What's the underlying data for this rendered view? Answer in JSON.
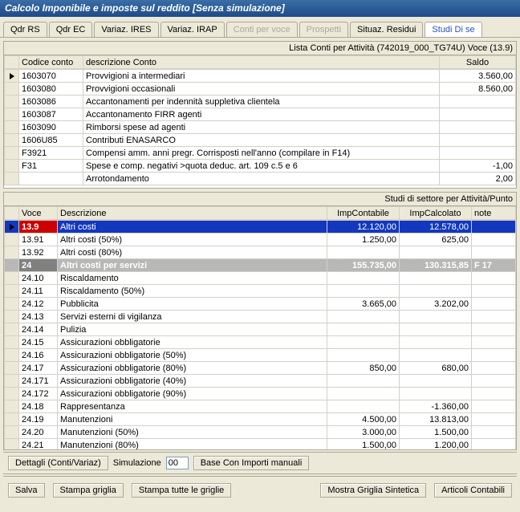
{
  "title": "Calcolo Imponibile e imposte sul reddito [Senza simulazione]",
  "tabs": [
    {
      "label": "Qdr RS",
      "state": "normal"
    },
    {
      "label": "Qdr EC",
      "state": "normal"
    },
    {
      "label": "Variaz. IRES",
      "state": "normal"
    },
    {
      "label": "Variaz. IRAP",
      "state": "normal"
    },
    {
      "label": "Conti per voce",
      "state": "disabled"
    },
    {
      "label": "Prospetti",
      "state": "disabled"
    },
    {
      "label": "Situaz. Residui",
      "state": "normal"
    },
    {
      "label": "Studi Di se",
      "state": "active"
    }
  ],
  "grid1": {
    "header_title": "Lista Conti per Attività (742019_000_TG74U)  Voce (13.9)",
    "columns": [
      "Codice conto",
      "descrizione Conto",
      "Saldo"
    ],
    "rows": [
      {
        "indicator": true,
        "codice": "1603070",
        "desc": "Provvigioni a intermediari",
        "saldo": "3.560,00"
      },
      {
        "codice": "1603080",
        "desc": "Provvigioni occasionali",
        "saldo": "8.560,00"
      },
      {
        "codice": "1603086",
        "desc": "Accantonamenti per indennità suppletiva clientela",
        "saldo": ""
      },
      {
        "codice": "1603087",
        "desc": "Accantonamento FIRR agenti",
        "saldo": ""
      },
      {
        "codice": "1603090",
        "desc": "Rimborsi spese ad agenti",
        "saldo": ""
      },
      {
        "codice": "1606U85",
        "desc": "Contributi ENASARCO",
        "saldo": ""
      },
      {
        "codice": "F3921",
        "desc": "Compensi amm. anni pregr. Corrisposti nell'anno (compilare in F14)",
        "saldo": ""
      },
      {
        "codice": "F31",
        "desc": "Spese e comp. negativi >quota deduc. art. 109 c.5 e 6",
        "saldo": "-1,00"
      },
      {
        "codice": "",
        "desc": "Arrotondamento",
        "saldo": "2,00"
      }
    ]
  },
  "grid2": {
    "header_title": "Studi di settore per  Attività/Punto",
    "columns": [
      "Voce",
      "Descrizione",
      "ImpContabile",
      "ImpCalcolato",
      "note"
    ],
    "rows": [
      {
        "indicator": true,
        "style": "sel-red",
        "voce": "13.9",
        "desc": "Altri costi",
        "impcont": "12.120,00",
        "impcalc": "12.578,00",
        "note": ""
      },
      {
        "voce": "13.91",
        "desc": "Altri costi (50%)",
        "impcont": "1.250,00",
        "impcalc": "625,00",
        "note": ""
      },
      {
        "voce": "13.92",
        "desc": "Altri costi (80%)",
        "impcont": "",
        "impcalc": "",
        "note": ""
      },
      {
        "style": "sel-grey",
        "voce": "24",
        "desc": "Altri costi per servizi",
        "impcont": "155.735,00",
        "impcalc": "130.315,85",
        "note": "F 17"
      },
      {
        "voce": "24.10",
        "desc": "Riscaldamento",
        "impcont": "",
        "impcalc": "",
        "note": ""
      },
      {
        "voce": "24.11",
        "desc": "Riscaldamento (50%)",
        "impcont": "",
        "impcalc": "",
        "note": ""
      },
      {
        "voce": "24.12",
        "desc": "Pubblicita",
        "impcont": "3.665,00",
        "impcalc": "3.202,00",
        "note": ""
      },
      {
        "voce": "24.13",
        "desc": "Servizi esterni di vigilanza",
        "impcont": "",
        "impcalc": "",
        "note": ""
      },
      {
        "voce": "24.14",
        "desc": "Pulizia",
        "impcont": "",
        "impcalc": "",
        "note": ""
      },
      {
        "voce": "24.15",
        "desc": "Assicurazioni obbligatorie",
        "impcont": "",
        "impcalc": "",
        "note": ""
      },
      {
        "voce": "24.16",
        "desc": "Assicurazioni obbligatorie (50%)",
        "impcont": "",
        "impcalc": "",
        "note": ""
      },
      {
        "voce": "24.17",
        "desc": "Assicurazioni obbligatorie (80%)",
        "impcont": "850,00",
        "impcalc": "680,00",
        "note": ""
      },
      {
        "voce": "24.171",
        "desc": "Assicurazioni obbligatorie (40%)",
        "impcont": "",
        "impcalc": "",
        "note": ""
      },
      {
        "voce": "24.172",
        "desc": "Assicurazioni obbligatorie (90%)",
        "impcont": "",
        "impcalc": "",
        "note": ""
      },
      {
        "voce": "24.18",
        "desc": "Rappresentanza",
        "impcont": "",
        "impcalc": "-1.360,00",
        "note": ""
      },
      {
        "voce": "24.19",
        "desc": "Manutenzioni",
        "impcont": "4.500,00",
        "impcalc": "13.813,00",
        "note": ""
      },
      {
        "voce": "24.20",
        "desc": "Manutenzioni (50%)",
        "impcont": "3.000,00",
        "impcalc": "1.500,00",
        "note": ""
      },
      {
        "voce": "24.21",
        "desc": "Manutenzioni (80%)",
        "impcont": "1.500,00",
        "impcalc": "1.200,00",
        "note": ""
      }
    ]
  },
  "toolbar": {
    "dettagli": "Dettagli (Conti/Variaz)",
    "sim_label": "Simulazione",
    "sim_value": "00",
    "base": "Base Con Importi manuali"
  },
  "actions": {
    "salva": "Salva",
    "stampa_griglia": "Stampa griglia",
    "stampa_tutte": "Stampa tutte le griglie",
    "mostra": "Mostra Griglia Sintetica",
    "articoli": "Articoli Contabili"
  }
}
